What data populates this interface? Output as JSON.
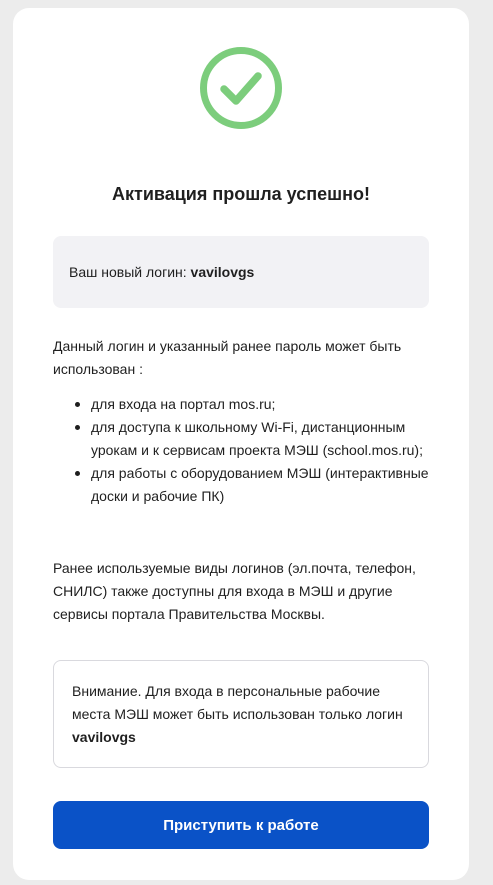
{
  "header": {
    "title": "Активация прошла успешно!"
  },
  "icons": {
    "success": "check-circle-icon",
    "success_color": "#7ccd7c"
  },
  "login_box": {
    "label": "Ваш новый логин: ",
    "value": "vavilovgs"
  },
  "usage": {
    "intro": "Данный логин и указанный ранее пароль может быть использован :",
    "items": [
      "для входа на портал mos.ru;",
      "для доступа к школьному Wi-Fi, дистанционным урокам и к сервисам проекта МЭШ (school.mos.ru);",
      "для работы с оборудованием МЭШ (интерактивные доски и рабочие ПК)"
    ]
  },
  "legacy_info": "Ранее используемые виды логинов (эл.почта, телефон, СНИЛС) также доступны для входа в МЭШ и другие сервисы портала Правительства Москвы.",
  "notice": {
    "text": "Внимание. Для входа в персональные рабочие места МЭШ может быть использован только логин ",
    "login": "vavilovgs"
  },
  "actions": {
    "start_label": "Приступить к работе",
    "button_color": "#0a52c7"
  }
}
